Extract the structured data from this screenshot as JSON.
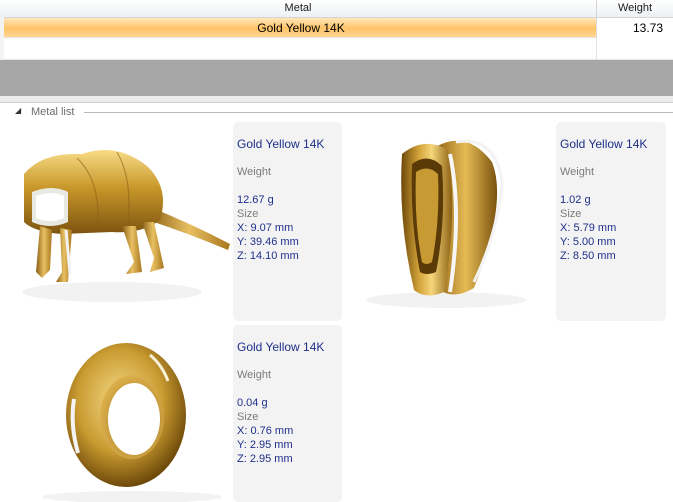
{
  "grid": {
    "columns": {
      "metal": "Metal",
      "weight": "Weight"
    },
    "rows": [
      {
        "metal": "Gold Yellow 14K",
        "weight": "13.73"
      }
    ]
  },
  "metal_list": {
    "title": "Metal list",
    "items": [
      {
        "name": "Gold Yellow 14K",
        "weight_label": "Weight",
        "weight": "12.67 g",
        "size_label": "Size",
        "x": "X: 9.07 mm",
        "y": "Y: 39.46 mm",
        "z": "Z: 14.10 mm",
        "thumbnail": "armadillo-pendant"
      },
      {
        "name": "Gold Yellow 14K",
        "weight_label": "Weight",
        "weight": "1.02 g",
        "size_label": "Size",
        "x": "X: 5.79 mm",
        "y": "Y: 5.00 mm",
        "z": "Z: 8.50 mm",
        "thumbnail": "bail"
      },
      {
        "name": "Gold Yellow 14K",
        "weight_label": "Weight",
        "weight": "0.04 g",
        "size_label": "Size",
        "x": "X: 0.76 mm",
        "y": "Y: 2.95 mm",
        "z": "Z: 2.95 mm",
        "thumbnail": "jump-ring"
      }
    ]
  },
  "colors": {
    "selection": "#ffc468",
    "gold": "#c89a2a",
    "value_text": "#1f2f8a",
    "band": "#a7a7a7"
  }
}
